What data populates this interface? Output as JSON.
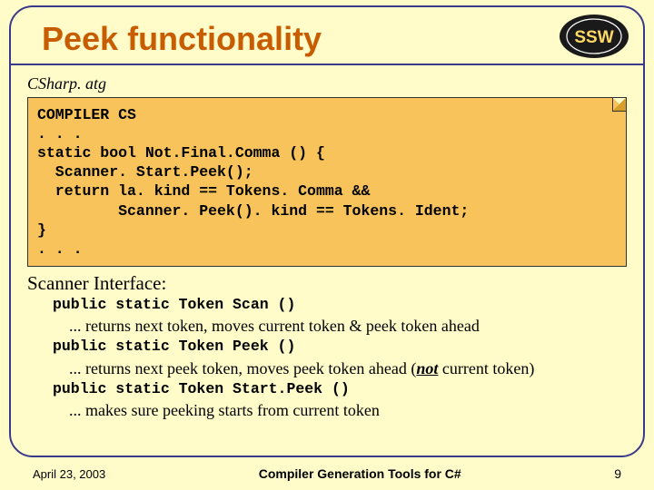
{
  "title": "Peek functionality",
  "filename": "CSharp. atg",
  "code": "COMPILER CS\n. . .\nstatic bool Not.Final.Comma () {\n  Scanner. Start.Peek();\n  return la. kind == Tokens. Comma &&\n         Scanner. Peek(). kind == Tokens. Ident;\n}\n. . .",
  "interface_heading": "Scanner Interface:",
  "iface": {
    "sig1": "public static Token Scan ()",
    "desc1": "... returns next token, moves current token & peek token ahead",
    "sig2": "public static Token Peek ()",
    "desc2a": "... returns next peek token, moves peek token ahead (",
    "desc2_not": "not",
    "desc2b": " current token)",
    "sig3": "public static Token Start.Peek ()",
    "desc3": "... makes sure peeking starts from current token"
  },
  "footer": {
    "date": "April 23, 2003",
    "title": "Compiler Generation Tools for C#",
    "page": "9"
  },
  "logo_text": "SSW",
  "colors": {
    "bg": "#fffcc9",
    "accent": "#c75c00",
    "border": "#3a3a8a",
    "codebg": "#f7c35a"
  }
}
